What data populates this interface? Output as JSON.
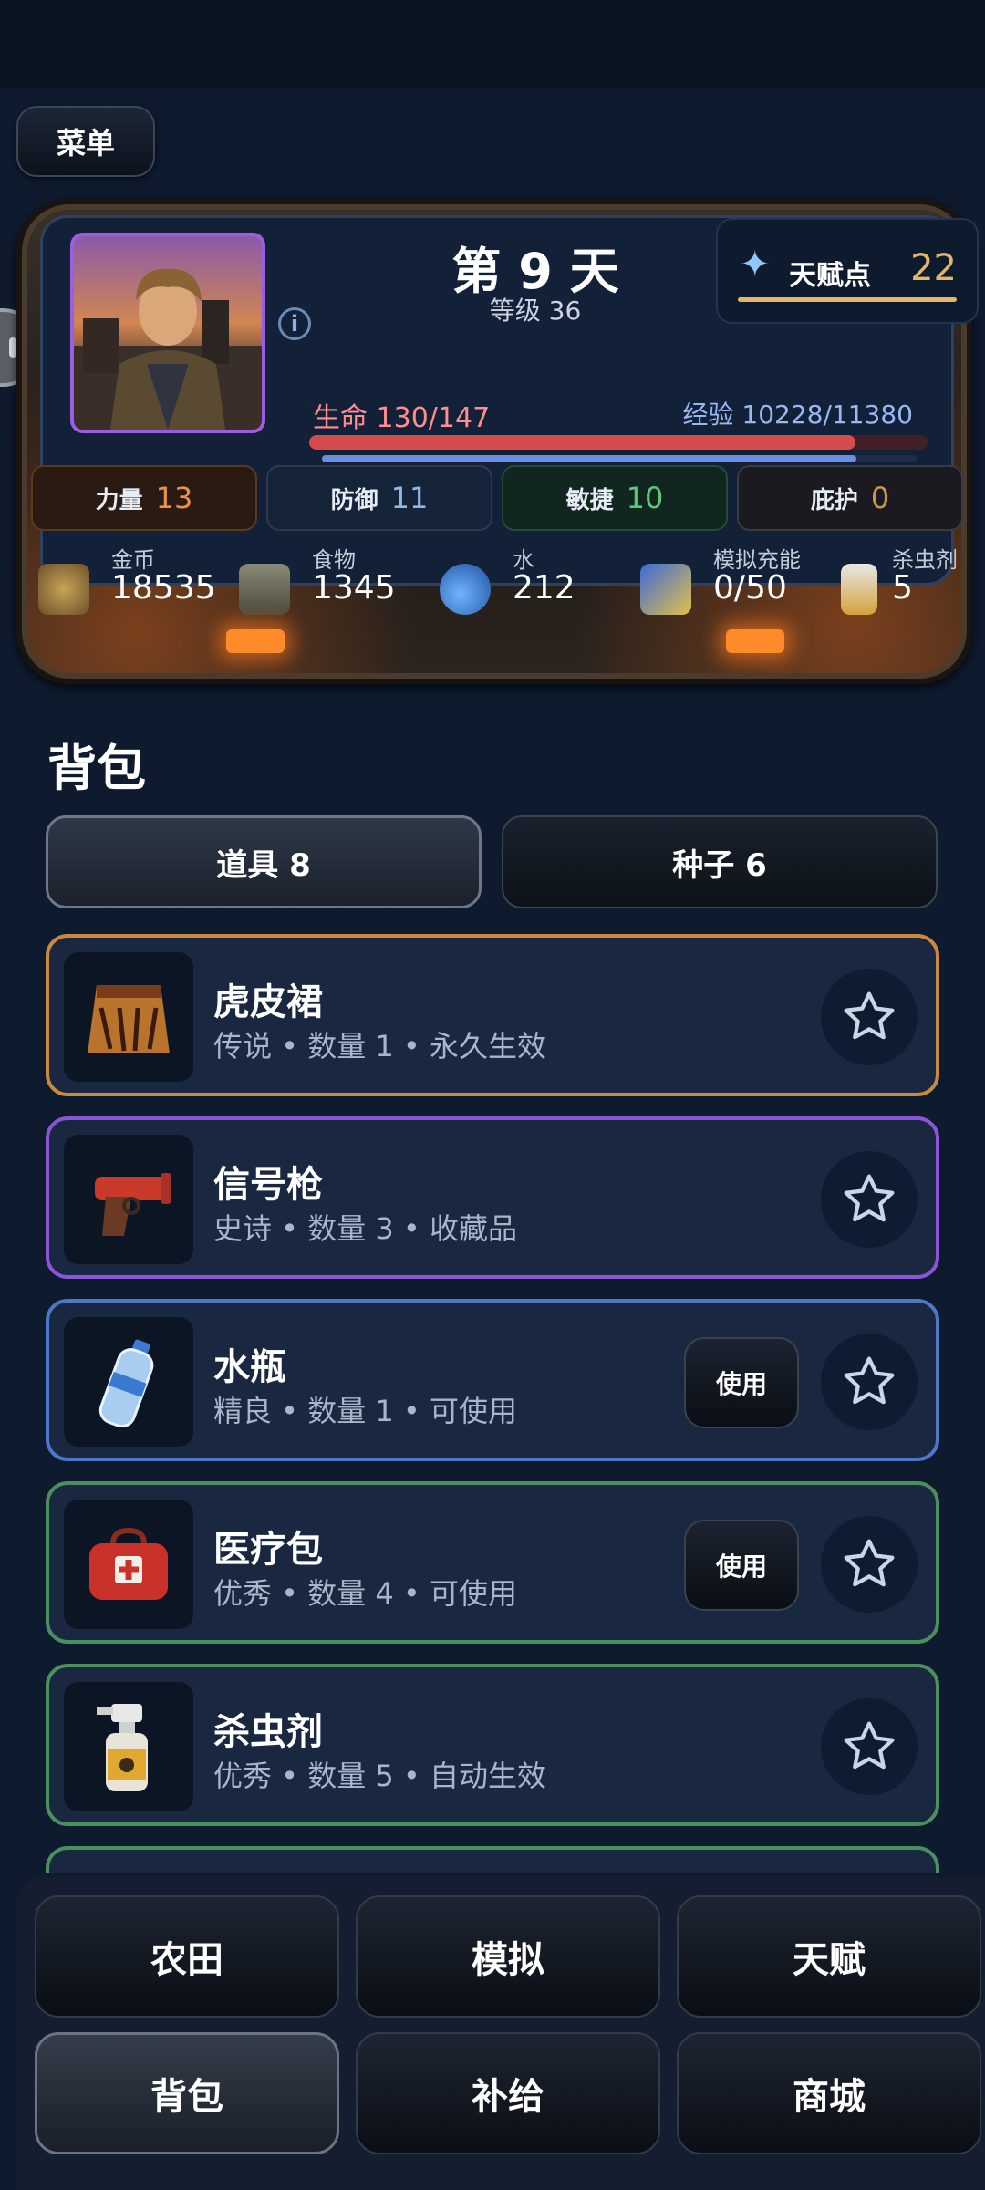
{
  "menu": {
    "label": "菜单"
  },
  "status": {
    "day": "第 9 天",
    "level": "等级 36",
    "talent_label": "天赋点",
    "talent_value": "22",
    "hp_label": "生命 130/147",
    "hp_fraction": 0.884,
    "exp_label": "经验 10228/11380",
    "exp_fraction": 0.899,
    "stats": [
      {
        "label": "力量",
        "value": "13",
        "color": "#e8934a"
      },
      {
        "label": "防御",
        "value": "11",
        "color": "#8fb8e8"
      },
      {
        "label": "敏捷",
        "value": "10",
        "color": "#5fc77a"
      },
      {
        "label": "庇护",
        "value": "0",
        "color": "#c8974a"
      }
    ],
    "resources": [
      {
        "label": "金币",
        "value": "18535",
        "icon": "coins-icon"
      },
      {
        "label": "食物",
        "value": "1345",
        "icon": "food-icon"
      },
      {
        "label": "水",
        "value": "212",
        "icon": "water-icon"
      },
      {
        "label": "模拟充能",
        "value": "0/50",
        "icon": "battery-icon"
      },
      {
        "label": "杀虫剂",
        "value": "5",
        "icon": "spray-icon"
      }
    ]
  },
  "bag": {
    "title": "背包",
    "tabs": [
      {
        "label": "道具 8"
      },
      {
        "label": "种子 6"
      }
    ],
    "items": [
      {
        "name": "虎皮裙",
        "meta": "传说 • 数量 1 • 永久生效",
        "border": "#c98a3c",
        "use": "",
        "icon": "tiger-skirt-icon"
      },
      {
        "name": "信号枪",
        "meta": "史诗 • 数量 3 • 收藏品",
        "border": "#8a55d6",
        "use": "",
        "icon": "flare-gun-icon"
      },
      {
        "name": "水瓶",
        "meta": "精良 • 数量 1 • 可使用",
        "border": "#4d78c8",
        "use": "使用",
        "icon": "water-bottle-icon"
      },
      {
        "name": "医疗包",
        "meta": "优秀 • 数量 4 • 可使用",
        "border": "#4c8f5f",
        "use": "使用",
        "icon": "medkit-icon"
      },
      {
        "name": "杀虫剂",
        "meta": "优秀 • 数量 5 • 自动生效",
        "border": "#4c8f5f",
        "use": "",
        "icon": "spray-icon"
      }
    ]
  },
  "nav": {
    "items": [
      {
        "label": "农田"
      },
      {
        "label": "模拟"
      },
      {
        "label": "天赋"
      },
      {
        "label": "背包"
      },
      {
        "label": "补给"
      },
      {
        "label": "商城"
      }
    ],
    "active_index": 3
  }
}
